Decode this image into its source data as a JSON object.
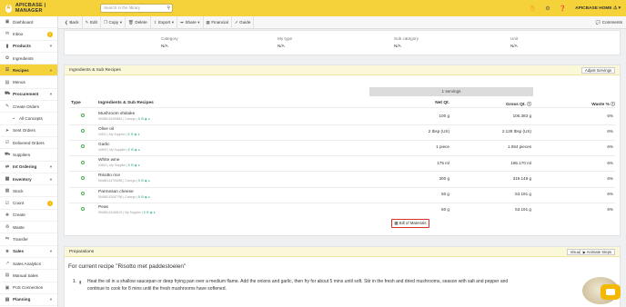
{
  "app": {
    "logo_text": "APICBASE | MANAGER",
    "search_placeholder": "Search in the library",
    "home_label": "APICBASE HOME"
  },
  "sidebar": {
    "items": [
      {
        "label": "Dashboard",
        "icon": "dashboard-icon"
      },
      {
        "label": "Inbox",
        "icon": "inbox-icon",
        "badge": "2"
      },
      {
        "label": "Products",
        "icon": "products-icon"
      },
      {
        "label": "Ingredients",
        "icon": "ingredients-icon"
      },
      {
        "label": "Recipes",
        "icon": "recipes-icon"
      },
      {
        "label": "Menus",
        "icon": "menus-icon"
      },
      {
        "label": "Procurement",
        "icon": "procurement-icon"
      },
      {
        "label": "Create Orders",
        "icon": "create-orders-icon"
      },
      {
        "label": "All Concepts",
        "icon": "concepts-icon"
      },
      {
        "label": "Sent Orders",
        "icon": "sent-orders-icon"
      },
      {
        "label": "Delivered Orders",
        "icon": "delivered-orders-icon"
      },
      {
        "label": "Suppliers",
        "icon": "suppliers-icon"
      },
      {
        "label": "Int Ordering",
        "icon": "int-ordering-icon"
      },
      {
        "label": "Inventory",
        "icon": "inventory-icon"
      },
      {
        "label": "Stock",
        "icon": "stock-icon"
      },
      {
        "label": "Count",
        "icon": "count-icon",
        "badge": "1"
      },
      {
        "label": "Create",
        "icon": "create-icon"
      },
      {
        "label": "Waste",
        "icon": "waste-icon"
      },
      {
        "label": "Transfer",
        "icon": "transfer-icon"
      },
      {
        "label": "Sales",
        "icon": "sales-icon"
      },
      {
        "label": "Sales Analytics",
        "icon": "sales-analytics-icon"
      },
      {
        "label": "Manual Sales",
        "icon": "manual-sales-icon"
      },
      {
        "label": "PoS Connection",
        "icon": "pos-icon"
      },
      {
        "label": "Planning",
        "icon": "planning-icon"
      }
    ]
  },
  "toolbar": {
    "back": "Back",
    "edit": "Edit",
    "copy": "Copy",
    "delete": "Delete",
    "export": "Export",
    "share": "Share",
    "financial": "Financial",
    "guide": "Guide",
    "comments": "Comments"
  },
  "details": {
    "category_label": "Category",
    "category_value": "N/A",
    "mytype_label": "My type",
    "mytype_value": "N/A",
    "subcategory_label": "Sub category",
    "subcategory_value": "N/A",
    "unit_label": "Unit",
    "unit_value": "N/A"
  },
  "ingredients_panel": {
    "title": "Ingredients & Sub Recipes",
    "adjust_servings": "Adjust Servings",
    "servings": "1 servings",
    "col_type": "Type",
    "col_name": "Ingredients & Sub Recipes",
    "col_net": "Net Qt.",
    "col_gross": "Gross Qt.",
    "col_waste": "Waste %",
    "rows": [
      {
        "name": "Mushroom shiitake",
        "sub": "59488143459851 | Comrgo |",
        "net": "100 g",
        "gross": "106.383 g",
        "waste": "6%"
      },
      {
        "name": "Olive oil",
        "sub": "44511 | My Supplier |",
        "net": "2 tbsp (US)",
        "gross": "2.128 tbsp (US)",
        "waste": "6%"
      },
      {
        "name": "Garlic",
        "sub": "44509 | My Supplier |",
        "net": "1 piece",
        "gross": "1.064 pieces",
        "waste": "6%"
      },
      {
        "name": "White wine",
        "sub": "44510 | My Supplier |",
        "net": "175 ml",
        "gross": "186.170 ml",
        "waste": "6%"
      },
      {
        "name": "Risotto rice",
        "sub": "55488143705285 | Comrgo |",
        "net": "300 g",
        "gross": "319.149 g",
        "waste": "6%"
      },
      {
        "name": "Parmesan cheese",
        "sub": "55488143087786 | Comrgo |",
        "net": "50 g",
        "gross": "53.191 g",
        "waste": "6%"
      },
      {
        "name": "Peas",
        "sub": "55488143168101 | My Supplier |",
        "net": "50 g",
        "gross": "53.191 g",
        "waste": "6%"
      }
    ],
    "bom_button": "Bill of Materials"
  },
  "preparations": {
    "title": "Preparations",
    "visual": "Visual",
    "animate": "Animate Steps",
    "recipe_title": "For current recipe \"Risotto met paddestoelen\"",
    "step_num": "1.",
    "step_text": "Heat the oil in a shallow saucepan or deep frying pan over a medium flame. Add the onions and garlic, then fry for about 5 mins until soft. Stir in the fresh and dried mushrooms, season with salt and pepper and continue to cook for 8 mins until the fresh mushrooms have softened."
  },
  "colors": {
    "brand_yellow": "#f5d23a",
    "status_green": "#4caf50",
    "highlight_red": "#d9332a"
  }
}
